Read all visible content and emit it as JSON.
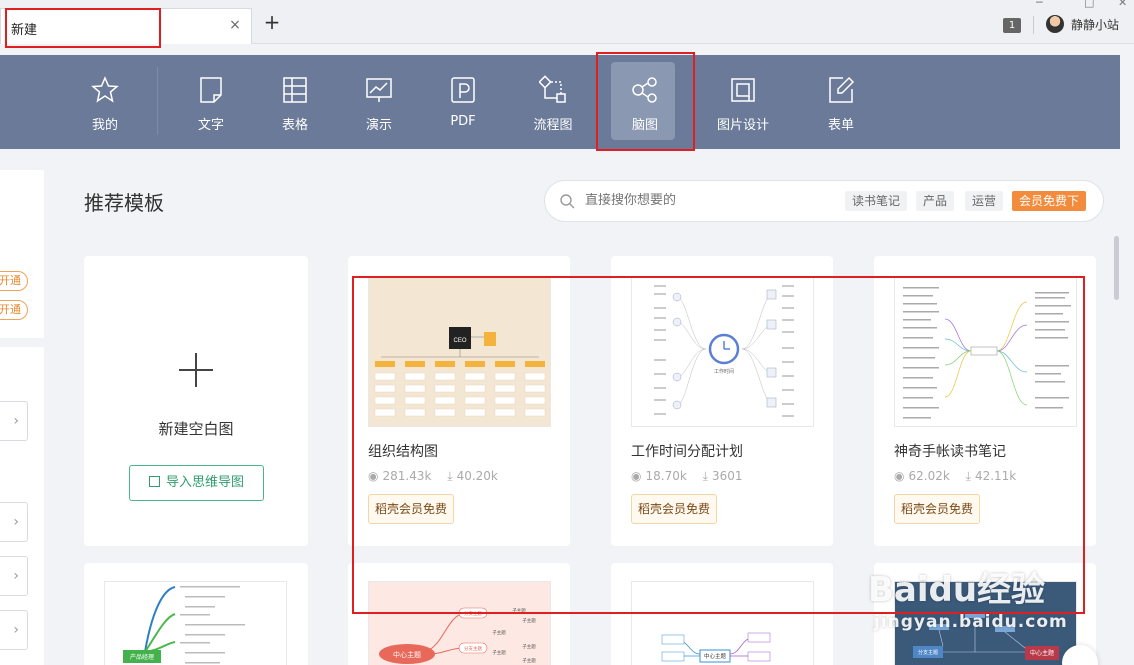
{
  "tab": {
    "title": "新建",
    "close": "×",
    "add": "+"
  },
  "window": {
    "badge_count": "1",
    "user_name": "静静小站"
  },
  "nav": {
    "items": [
      {
        "label": "我的",
        "icon": "star-icon"
      },
      {
        "label": "文字",
        "icon": "document-icon"
      },
      {
        "label": "表格",
        "icon": "table-icon"
      },
      {
        "label": "演示",
        "icon": "presentation-icon"
      },
      {
        "label": "PDF",
        "icon": "pdf-icon"
      },
      {
        "label": "流程图",
        "icon": "flowchart-icon"
      },
      {
        "label": "脑图",
        "icon": "mindmap-icon",
        "active": true
      },
      {
        "label": "图片设计",
        "icon": "image-design-icon"
      },
      {
        "label": "表单",
        "icon": "form-icon"
      }
    ]
  },
  "sidebar": {
    "pill1": "开通",
    "pill2": "开通",
    "arrow": "›"
  },
  "main": {
    "section_title": "推荐模板",
    "search": {
      "placeholder": "直接搜你想要的",
      "tags": [
        "读书笔记",
        "产品",
        "运营"
      ],
      "vip_tag": "会员免费下"
    },
    "new_card": {
      "label": "新建空白图",
      "import_label": "导入思维导图"
    },
    "templates": [
      {
        "name": "组织结构图",
        "views": "281.43k",
        "downloads": "40.20k",
        "badge": "稻壳会员免费"
      },
      {
        "name": "工作时间分配计划",
        "views": "18.70k",
        "downloads": "3601",
        "badge": "稻壳会员免费"
      },
      {
        "name": "神奇手帐读书笔记",
        "views": "62.02k",
        "downloads": "42.11k",
        "badge": "稻壳会员免费"
      }
    ],
    "bottom_thumbs": [
      {
        "center_label": "产品经理"
      },
      {
        "center_label": "中心主题"
      },
      {
        "center_label": "中心主题"
      },
      {
        "center_label": "中心主题"
      }
    ]
  },
  "thumb_text": {
    "ceo": "CEO",
    "clock_caption": "工作时间",
    "branch": "分支主题",
    "sub": "子主题"
  },
  "watermark": {
    "main": "Baidu经验",
    "sub": "jingyan.baidu.com"
  },
  "colors": {
    "nav_bg": "#6a7a98",
    "highlight": "#e02020",
    "vip_orange": "#f28b3c",
    "accent_green": "#2f9e6e"
  }
}
